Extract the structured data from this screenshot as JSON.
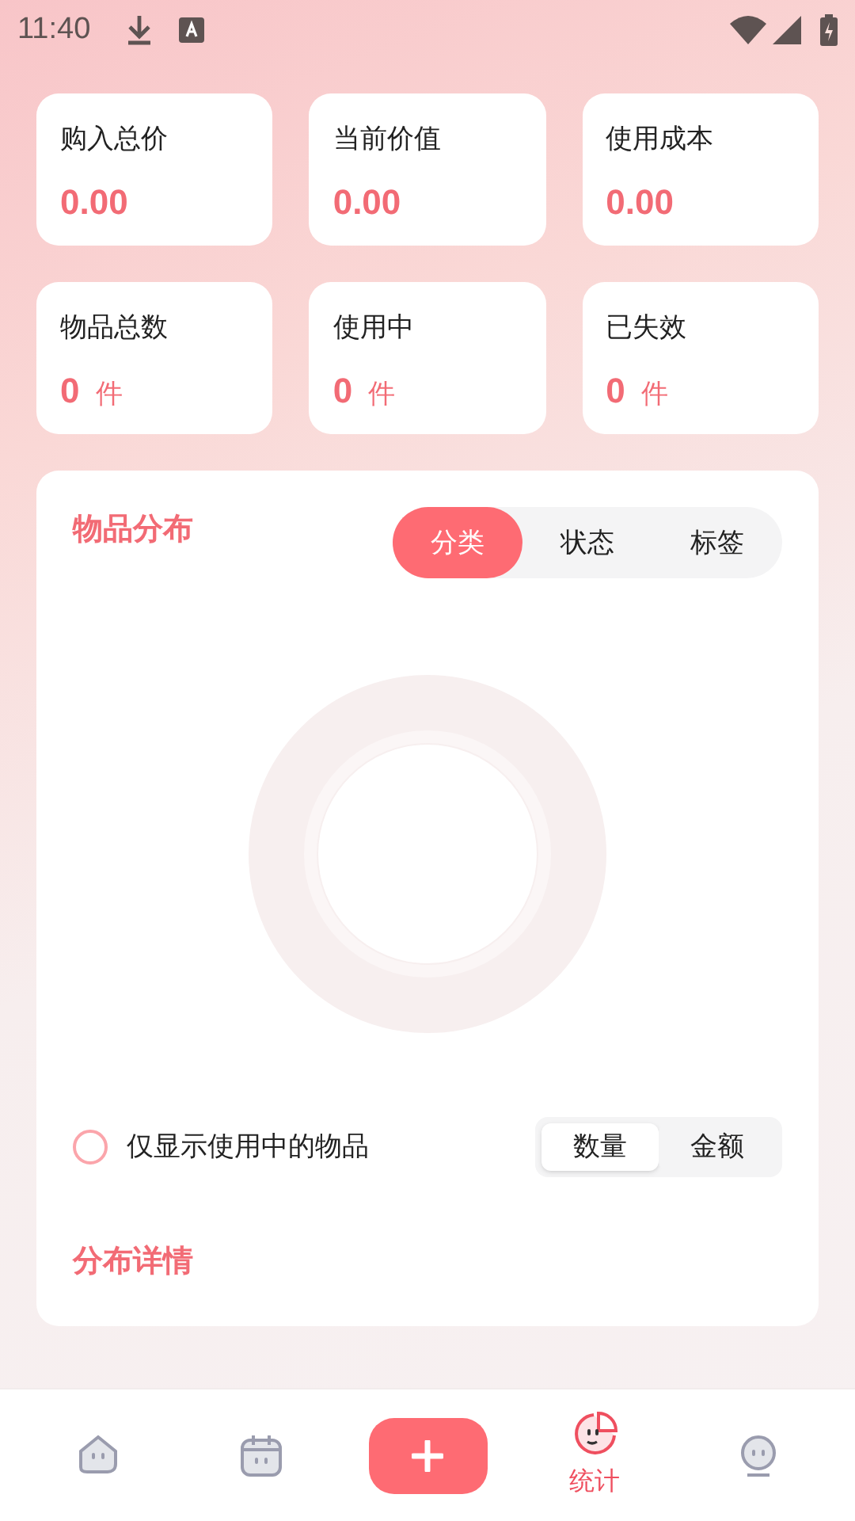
{
  "status_bar": {
    "time": "11:40"
  },
  "summary_cards": [
    {
      "label": "购入总价",
      "value": "0.00"
    },
    {
      "label": "当前价值",
      "value": "0.00"
    },
    {
      "label": "使用成本",
      "value": "0.00"
    },
    {
      "label": "物品总数",
      "value": "0",
      "unit": "件"
    },
    {
      "label": "使用中",
      "value": "0",
      "unit": "件"
    },
    {
      "label": "已失效",
      "value": "0",
      "unit": "件"
    }
  ],
  "distribution": {
    "title": "物品分布",
    "tabs": [
      {
        "label": "分类",
        "selected": true
      },
      {
        "label": "状态",
        "selected": false
      },
      {
        "label": "标签",
        "selected": false
      }
    ],
    "filter": {
      "label": "仅显示使用中的物品",
      "checked": false
    },
    "measure": [
      {
        "label": "数量",
        "selected": true
      },
      {
        "label": "金额",
        "selected": false
      }
    ],
    "details_title": "分布详情"
  },
  "bottom_nav": [
    {
      "kind": "home",
      "selected": false
    },
    {
      "kind": "calendar",
      "selected": false
    },
    {
      "kind": "add",
      "selected": false
    },
    {
      "kind": "stats",
      "label": "统计",
      "selected": true
    },
    {
      "kind": "profile",
      "selected": false
    }
  ]
}
